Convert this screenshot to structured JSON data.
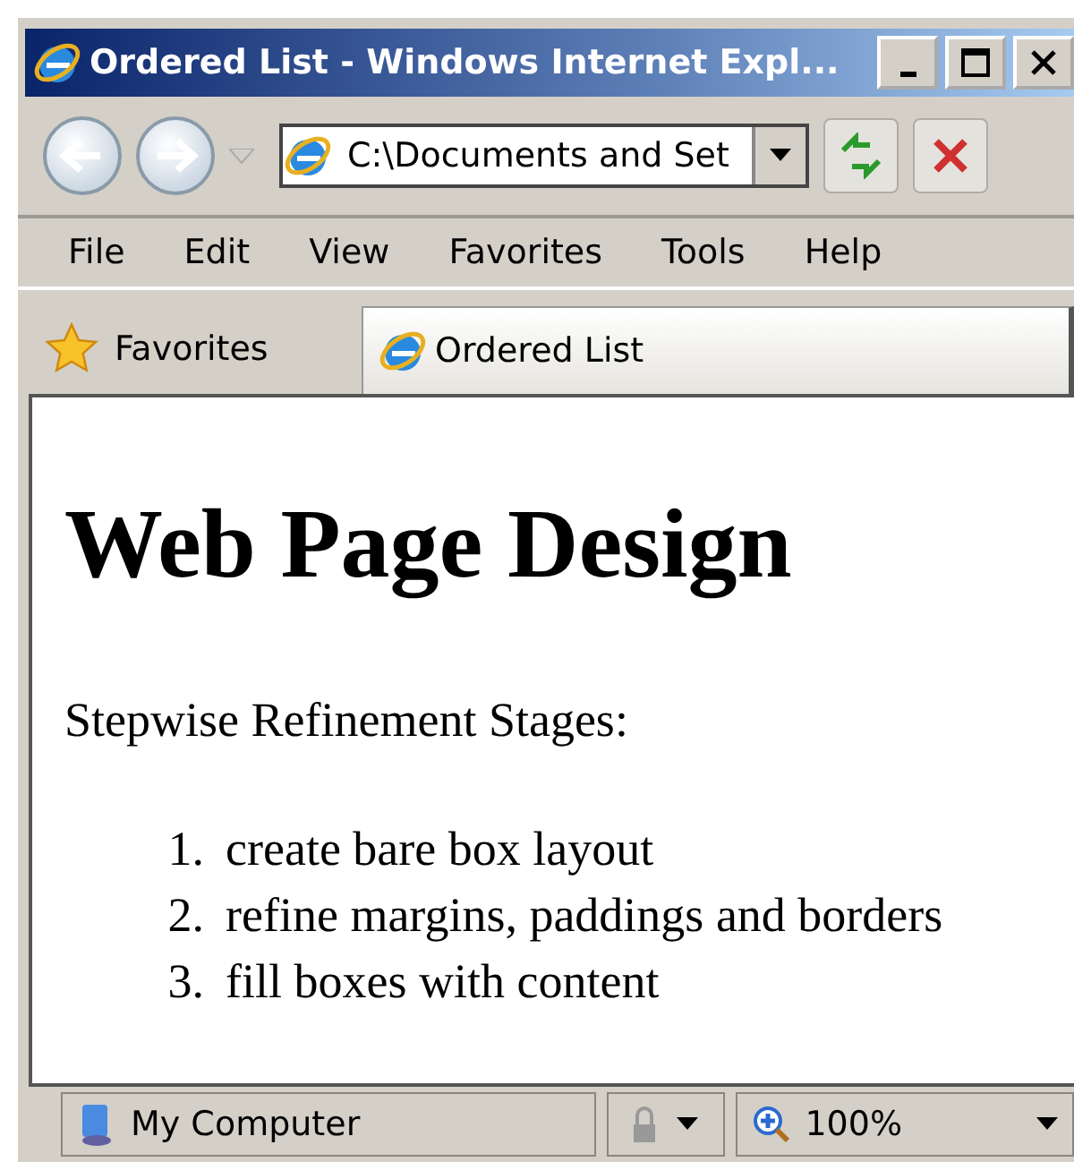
{
  "window": {
    "title": "Ordered List - Windows Internet Expl..."
  },
  "address_bar": {
    "value": "C:\\Documents and Set"
  },
  "menu": [
    "File",
    "Edit",
    "View",
    "Favorites",
    "Tools",
    "Help"
  ],
  "favorites": {
    "label": "Favorites"
  },
  "tabs": [
    {
      "label": "Ordered List",
      "selected": true
    }
  ],
  "page": {
    "heading": "Web Page Design",
    "intro": "Stepwise Refinement Stages:",
    "list": [
      {
        "number": "1.",
        "text": "create bare box layout"
      },
      {
        "number": "2.",
        "text": "refine margins, paddings and borders"
      },
      {
        "number": "3.",
        "text": "fill boxes with content"
      }
    ]
  },
  "status_bar": {
    "zone": "My Computer",
    "zoom": "100%"
  }
}
